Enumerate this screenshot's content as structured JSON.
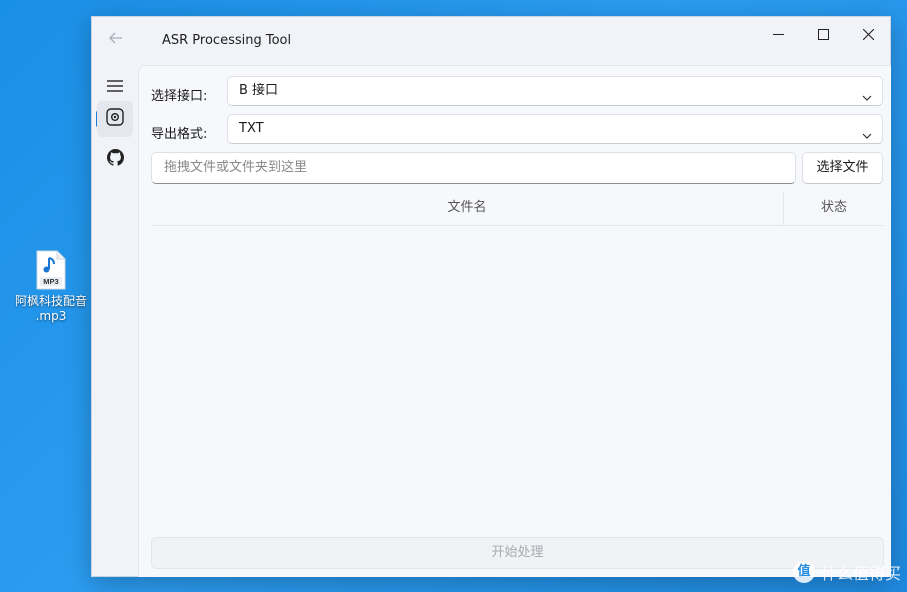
{
  "desktop": {
    "file_icon_badge": "MP3",
    "file_label_line1": "阿枫科技配音",
    "file_label_line2": ".mp3"
  },
  "window": {
    "title": "ASR Processing Tool",
    "nav_items": [
      "menu-icon",
      "record-icon",
      "github-icon"
    ],
    "form": {
      "interface_label": "选择接口:",
      "interface_value": "B 接口",
      "format_label": "导出格式:",
      "format_value": "TXT",
      "drop_placeholder": "拖拽文件或文件夹到这里",
      "choose_file_label": "选择文件"
    },
    "table": {
      "columns": [
        "文件名",
        "状态"
      ],
      "rows": []
    },
    "start_button_label": "开始处理"
  },
  "watermark": {
    "badge": "值",
    "text": "什么值得买"
  },
  "colors": {
    "accent": "#1e7fd6",
    "desktop_bg": "#2b9cf0"
  }
}
